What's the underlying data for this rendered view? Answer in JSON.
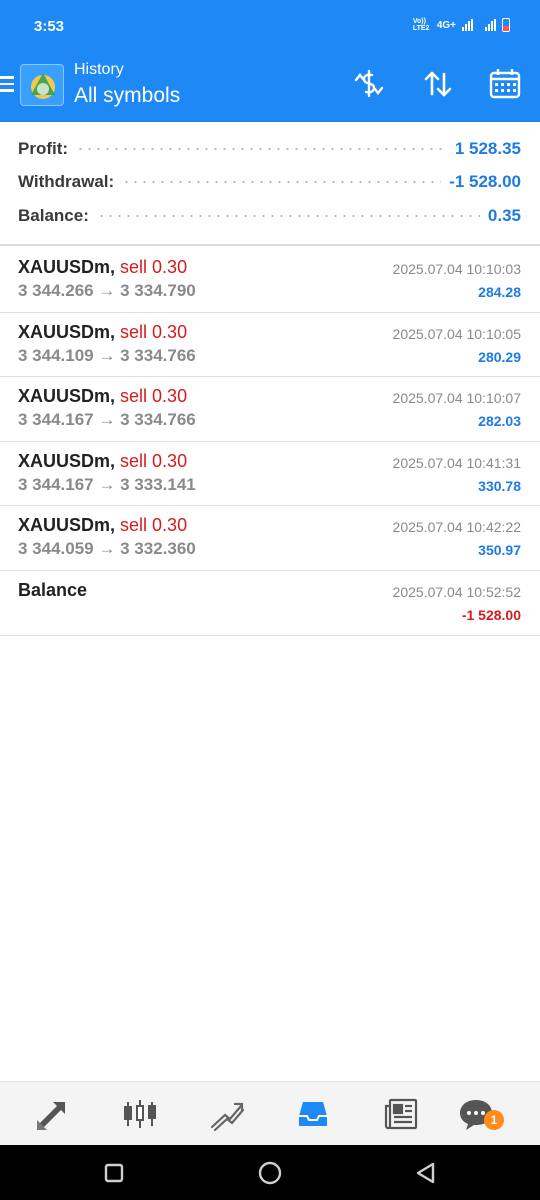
{
  "status_bar": {
    "time": "3:53",
    "network": "4G+",
    "volte": "Vo)) LTE2"
  },
  "app_bar": {
    "subtitle": "History",
    "title": "All symbols",
    "icons": [
      "menu-icon",
      "app-logo",
      "currency-exchange-icon",
      "sort-icon",
      "calendar-icon"
    ]
  },
  "summary": {
    "profit_label": "Profit:",
    "profit_value": "1 528.35",
    "withdrawal_label": "Withdrawal:",
    "withdrawal_value": "-1 528.00",
    "balance_label": "Balance:",
    "balance_value": "0.35"
  },
  "deals": [
    {
      "symbol": "XAUUSDm,",
      "side": "sell 0.30",
      "open": "3 344.266",
      "arrow": "→",
      "close": "3 334.790",
      "time": "2025.07.04 10:10:03",
      "profit": "284.28"
    },
    {
      "symbol": "XAUUSDm,",
      "side": "sell 0.30",
      "open": "3 344.109",
      "arrow": "→",
      "close": "3 334.766",
      "time": "2025.07.04 10:10:05",
      "profit": "280.29"
    },
    {
      "symbol": "XAUUSDm,",
      "side": "sell 0.30",
      "open": "3 344.167",
      "arrow": "→",
      "close": "3 334.766",
      "time": "2025.07.04 10:10:07",
      "profit": "282.03"
    },
    {
      "symbol": "XAUUSDm,",
      "side": "sell 0.30",
      "open": "3 344.167",
      "arrow": "→",
      "close": "3 333.141",
      "time": "2025.07.04 10:41:31",
      "profit": "330.78"
    },
    {
      "symbol": "XAUUSDm,",
      "side": "sell 0.30",
      "open": "3 344.059",
      "arrow": "→",
      "close": "3 332.360",
      "time": "2025.07.04 10:42:22",
      "profit": "350.97"
    }
  ],
  "balance_entry": {
    "label": "Balance",
    "time": "2025.07.04 10:52:52",
    "amount": "-1 528.00"
  },
  "bottom_nav": {
    "items": [
      "trade-icon",
      "quotes-icon",
      "chart-icon",
      "history-icon",
      "news-icon",
      "chat-icon"
    ],
    "active": "history-icon",
    "chat_badge": "1"
  },
  "system_nav": [
    "recents-icon",
    "home-icon",
    "back-icon"
  ],
  "colors": {
    "accent": "#1e88f5",
    "profit_blue": "#1e7be6",
    "sell_red": "#d51c1c",
    "badge_orange": "#ff8c1a"
  }
}
